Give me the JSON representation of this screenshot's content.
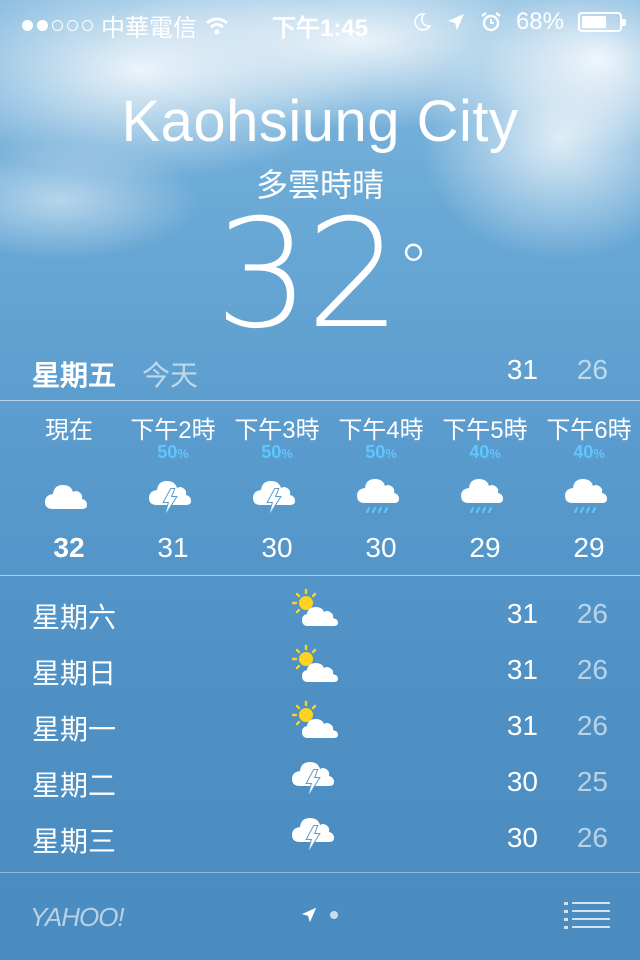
{
  "status_bar": {
    "signal_dots_filled": 2,
    "signal_dots_total": 5,
    "carrier": "中華電信",
    "time": "下午1:45",
    "battery": "68%",
    "battery_level": 0.68,
    "icons": [
      "wifi-icon",
      "moon-icon",
      "location-arrow-icon",
      "alarm-icon"
    ]
  },
  "location": {
    "city": "Kaohsiung City",
    "condition": "多雲時晴",
    "temperature": "32"
  },
  "today": {
    "day": "星期五",
    "tag": "今天",
    "high": "31",
    "low": "26"
  },
  "hourly": [
    {
      "label": "現在",
      "pop": "",
      "icon": "cloud-icon",
      "temp": "32"
    },
    {
      "label": "下午2時",
      "pop": "50",
      "icon": "thunderstorm-icon",
      "temp": "31"
    },
    {
      "label": "下午3時",
      "pop": "50",
      "icon": "thunderstorm-icon",
      "temp": "30"
    },
    {
      "label": "下午4時",
      "pop": "50",
      "icon": "rain-icon",
      "temp": "30"
    },
    {
      "label": "下午5時",
      "pop": "40",
      "icon": "rain-icon",
      "temp": "29"
    },
    {
      "label": "下午6時",
      "pop": "40",
      "icon": "rain-icon",
      "temp": "29"
    }
  ],
  "pop_unit": "%",
  "daily": [
    {
      "day": "星期六",
      "icon": "partly-sunny-icon",
      "high": "31",
      "low": "26"
    },
    {
      "day": "星期日",
      "icon": "partly-sunny-icon",
      "high": "31",
      "low": "26"
    },
    {
      "day": "星期一",
      "icon": "partly-sunny-icon",
      "high": "31",
      "low": "26"
    },
    {
      "day": "星期二",
      "icon": "thunderstorm-icon",
      "high": "30",
      "low": "25"
    },
    {
      "day": "星期三",
      "icon": "thunderstorm-icon",
      "high": "30",
      "low": "26"
    }
  ],
  "footer": {
    "brand": "YAHOO!",
    "icons": [
      "location-arrow-icon",
      "page-dot-icon",
      "list-menu-icon"
    ]
  },
  "colors": {
    "background_top": "#7fb7dd",
    "background_bottom": "#4a8bc0",
    "precipitation": "#5fc6ff",
    "sun": "#ffd21f"
  }
}
